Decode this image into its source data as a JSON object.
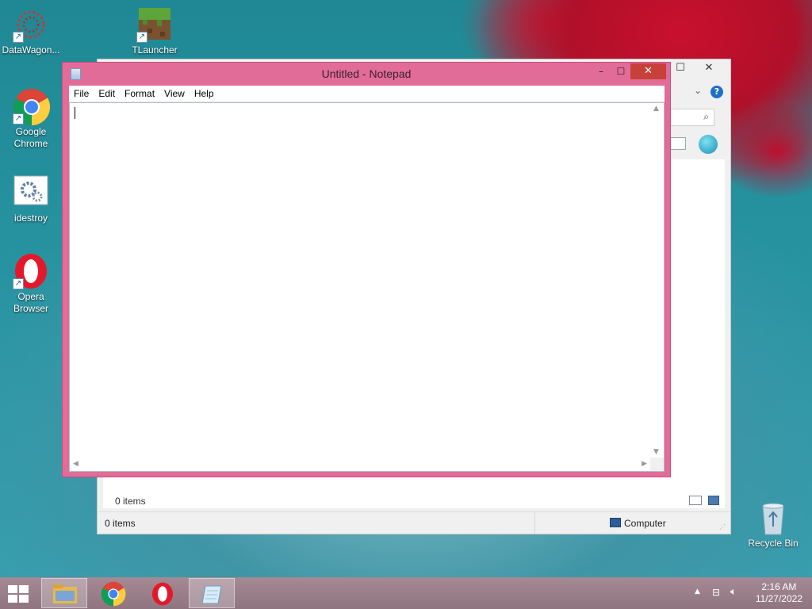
{
  "desktop": {
    "icons": [
      {
        "label": "DataWagon..."
      },
      {
        "label": "TLauncher"
      },
      {
        "label": "Google Chrome"
      },
      {
        "label": "idestroy"
      },
      {
        "label": "Opera Browser"
      },
      {
        "label": "Recycle Bin"
      }
    ]
  },
  "notepad": {
    "title": "Untitled - Notepad",
    "menu": [
      "File",
      "Edit",
      "Format",
      "View",
      "Help"
    ],
    "text": ""
  },
  "explorer": {
    "items_count": "0 items",
    "status_items": "0 items",
    "status_location": "Computer"
  },
  "taskbar": {
    "time": "2:16 AM",
    "date": "11/27/2022"
  },
  "colors": {
    "notepad_frame": "#e26c98",
    "close_button": "#c7403a",
    "desktop_teal": "#2a97a6",
    "flower_red": "#c8102e"
  }
}
